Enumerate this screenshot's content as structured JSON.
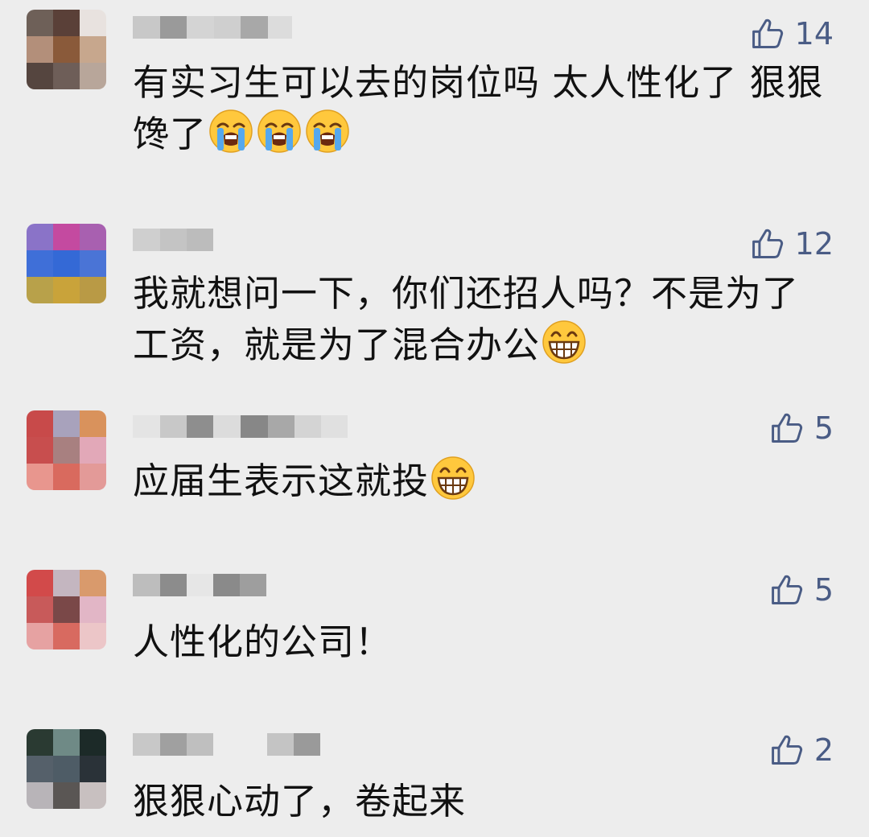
{
  "comments": [
    {
      "likes": "14",
      "text": "有实习生可以去的岗位吗 太人性化了 狠狠馋了",
      "emoji_icon": "loudly-crying-face-icon",
      "emoji_count": 3,
      "avatar_colors": [
        "#6e6058",
        "#5a4038",
        "#e8e2df",
        "#b38f7a",
        "#8a5a3a",
        "#c7a78d",
        "#55453f",
        "#6e5e58",
        "#b8a69a"
      ]
    },
    {
      "likes": "12",
      "text": "我就想问一下，你们还招人吗？不是为了工资，就是为了混合办公",
      "emoji_icon": "grinning-face-icon",
      "emoji_count": 1,
      "avatar_colors": [
        "#8a73c8",
        "#c44aa0",
        "#a860b0",
        "#3f6fd8",
        "#3469d6",
        "#4a74d6",
        "#b8a14a",
        "#c9a33a",
        "#b99a45"
      ]
    },
    {
      "likes": "5",
      "text": "应届生表示这就投",
      "emoji_icon": "grinning-face-icon",
      "emoji_count": 1,
      "avatar_colors": [
        "#c84a4a",
        "#a8a2bc",
        "#d9925c",
        "#c84e4e",
        "#a88080",
        "#e2a8b8",
        "#e8968e",
        "#d96a5e",
        "#e39a98"
      ]
    },
    {
      "likes": "5",
      "text": "人性化的公司！",
      "emoji_icon": "",
      "emoji_count": 0,
      "avatar_colors": [
        "#d24a4a",
        "#c4b6c0",
        "#d99a6c",
        "#c85a5a",
        "#7a4848",
        "#e2b6c6",
        "#e6a2a2",
        "#d86a60",
        "#ecc6c8"
      ]
    },
    {
      "likes": "2",
      "text": "狠狠心动了，卷起来",
      "emoji_icon": "",
      "emoji_count": 0,
      "avatar_colors": [
        "#2a3a32",
        "#6f8a86",
        "#1c2a28",
        "#55606a",
        "#4e5c66",
        "#2a3238",
        "#b8b4b8",
        "#5a5654",
        "#c8c0c0"
      ]
    }
  ],
  "icons": {
    "like": "thumbs-up-outline-icon"
  },
  "colors": {
    "background": "#ededed",
    "like_accent": "#4a5c85",
    "text": "#111111"
  }
}
